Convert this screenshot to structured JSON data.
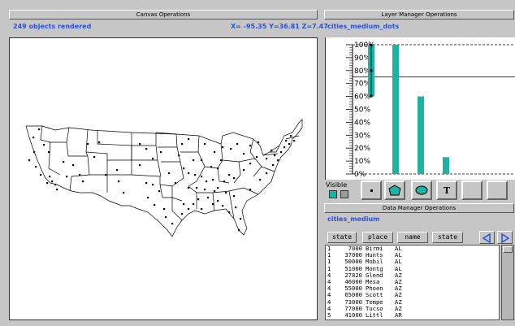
{
  "canvas": {
    "header": "Canvas Operations",
    "status": "249 objects rendered",
    "coords": "X= -95.35 Y=36.81 Z=7.47"
  },
  "layer": {
    "header": "Layer Manager Operations",
    "layer_name": "cities_medium_dots",
    "visible_label": "Visible",
    "tools": [
      "dot-icon",
      "polygon-icon",
      "ellipse-icon",
      "text-icon",
      "empty",
      "empty"
    ],
    "tool_text": {
      "text": "T"
    }
  },
  "chart_data": {
    "type": "bar",
    "ytick_labels": [
      "100%",
      "90%",
      "80%",
      "70%",
      "60%",
      "50%",
      "40%",
      "30%",
      "20%",
      "10%",
      "0%"
    ],
    "ylim": [
      0,
      100
    ],
    "reference_line": 75,
    "values": [
      {
        "low": 60,
        "high": 100,
        "marker": 80
      },
      {
        "low": 0,
        "high": 100
      },
      {
        "low": 0,
        "high": 60
      },
      {
        "low": 0,
        "high": 13
      }
    ],
    "colors": {
      "bar": "#1db3a3",
      "marker": "#000000",
      "grid": "#000000"
    }
  },
  "data_manager": {
    "header": "Data Manager Operations",
    "dataset": "cities_medium",
    "columns": [
      "state",
      "place",
      "name",
      "state"
    ],
    "rows": [
      [
        "1",
        "7000",
        "Birmi",
        "AL"
      ],
      [
        "1",
        "37000",
        "Hunts",
        "AL"
      ],
      [
        "1",
        "50000",
        "Mobil",
        "AL"
      ],
      [
        "1",
        "51000",
        "Montg",
        "AL"
      ],
      [
        "4",
        "27820",
        "Glend",
        "AZ"
      ],
      [
        "4",
        "46000",
        "Mesa",
        "AZ"
      ],
      [
        "4",
        "55000",
        "Phoen",
        "AZ"
      ],
      [
        "4",
        "65000",
        "Scott",
        "AZ"
      ],
      [
        "4",
        "73000",
        "Tempe",
        "AZ"
      ],
      [
        "4",
        "77000",
        "Tucso",
        "AZ"
      ],
      [
        "5",
        "41000",
        "Littl",
        "AR"
      ]
    ]
  },
  "colors": {
    "accent": "#2a50e6",
    "teal": "#1db3a3",
    "panel": "#c6c6c6"
  }
}
